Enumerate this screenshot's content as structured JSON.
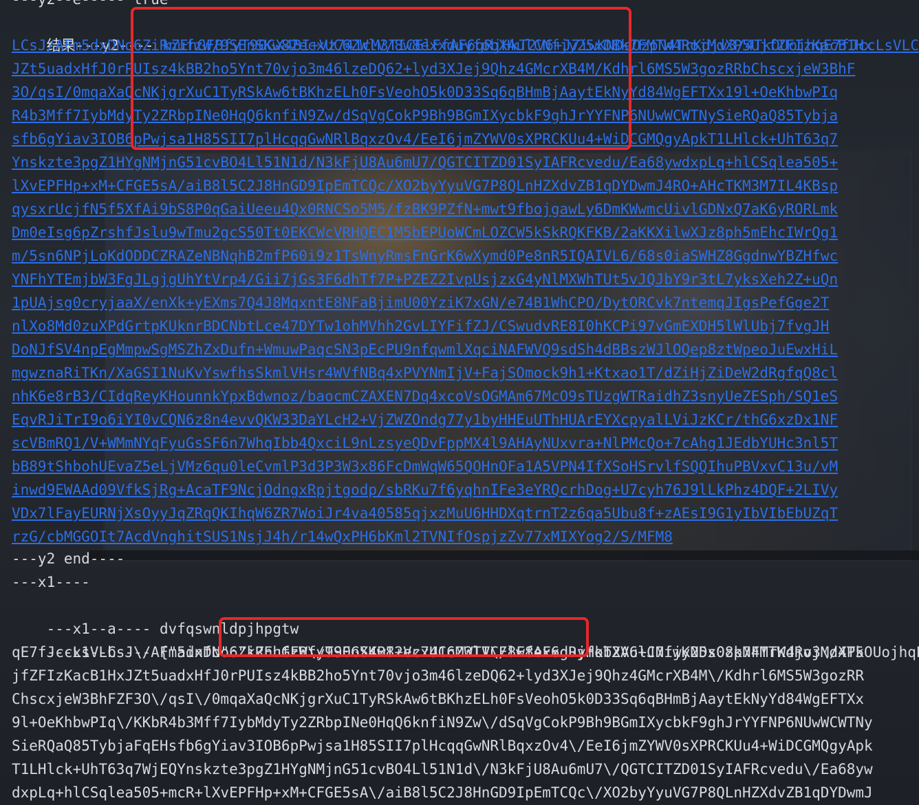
{
  "terminal": {
    "top_partial_line": "---y2--e----- true",
    "y2_prefix": "结果---y2---- ",
    "y2_lines": [
      "kZEhGFBfyT90GX4BI+Vz741cM3TICElFfAF6gRjHkT2V6+J7iwKNDsOzpN4TrKdjv3/4TkOUojhqE7fJccLsVLCsJ",
      "LCsJ/AFm5dxDNo6ZiRnufzW/9SEnSKw82ecxUC6ZWlV/8w8exxduyfobXAulCNfjy25x08k7FMTW4RojMdXP5UjfZFIzKacB1Hx",
      "JZt5uadxHfJ0rPUIsz4kBB2ho5Ynt70vjo3m46lzeDQ62+lyd3XJej9Qhz4GMcrXB4M/Kdhrl6MS5W3gozRRbChscxjeW3BhF",
      "3O/qsI/0mqaXaQcNKjgrXuC1TyRSkAw6tBKhzELh0FsVeohO5k0D33Sq6qBHmBjAaytEkNyYd84WgEFTXx19l+OeKhbwPIq",
      "R4b3Mff7IybMdyTy2ZRbpINe0HqQ6knfiN9Zw/dSqVgCokP9Bh9BGmIXycbkF9ghJrYYFNP6NUwWCWTNySieRQaQ85Tybja",
      "sfb6gYiav3IOB6pPwjsa1H85SII7plHcqqGwNRlBqxzOv4/EeI6jmZYWV0sXPRCKUu4+WiDCGMQgyApkT1LHlck+UhT63q7",
      "Ynskzte3pgZ1HYgNMjnG51cvBO4Ll51N1d/N3kFjU8Au6mU7/QGTCITZD01SyIAFRcvedu/Ea68ywdxpLq+hlCSqlea505+",
      "lXvEPFHp+xM+CFGE5sA/aiB8l5C2J8HnGD9IpEmTCQc/XO2byYyuVG7P8QLnHZXdvZB1qDYDwmJ4RO+AHcTKM3M7IL4KBsp",
      "qysxrUcjfN5f5XfAi9bS8P0qGaiUeeu4Qx0RNCSo5M5/fzBK9PZfN+mwt9fbojgawLy6DmKWwmcUivlGDNxQ7aK6yRORLmk",
      "Dm0eIsg6pZrshfJslu9wTmu2gcS50Tt0EKCWcVRHQEC1M5bEPUoWCmLOZCW5kSkRQKFKB/2aKKXilwXJz8ph5mEhcIWrQg1",
      "m/5sn6NPjLoKdODDCZRAZeNBNqhB2mfP60i9z1TsWnyRmsFnGrK6wXymd0Pe8nR5IQAIVL6/68s0iaSWHZ8GgdnwYBZHfwc",
      "YNFhYTEmjbW3FgJLgjgUhYtVrp4/Gii7jGs3F6dhTf7P+PZEZ2IvpUsjzxG4yNlMXWhTUt5vJQJbY9r3tL7yksXeh2Z+uQn",
      "1pUAjsg0cryjaaX/enXk+yEXms7Q4J8MqxntE8NFaBjimU00YziK7xGN/e74B1WhCPO/DytORCvk7ntemqJIgsPefGge2T",
      "nlXo8Md0zuXPdGrtpKUknrBDCNbtLce47DYTw1ohMVhh2GvLIYFifZJ/CSwudvRE8I0hKCPi97vGmEXDH5lWlUbj7fvgJH",
      "DoNJfSV4npEgMmpwSgMSZhZxDufn+WmuwPaqcSN3pEcPU9nfqwmlXqciNAFWVQ9sdSh4dBBszWJlOQep8ztWpeoJuEwxHiL",
      "mgwznaRiTKn/XaGSI1NuKvYswfhsSkmlVHsr4WVfNBq4xPVYNmIjV+FajSOmock9h1+Ktxao1T/dZiHjZiDeW2dRgfqQ8cl",
      "nhK6e8rB3/CIdqReyKHounnkYpxBdwnoz/baocmCZAXEN7Dq4xcoVsOGMAm67McO9sTUzgWTRaidhZ3snyUeZESph/SQ1eS",
      "EqvRJiTrI9o6iYI0vCQN6z8n4evvQKW33DaYLcH2+VjZWZOndg77y1byHHEuUThHUArEYXcpyalLViJzKCr/thG6xzDx1NF",
      "scVBmRQ1/V+WMmNYqFyuGsSF6n7WhqIbb4QxciL9nLzsyeQDvFppMX4l9AHAyNUxvra+NlPMcQo+7cAhg1JEdbYUHc3nl5T",
      "bB89tShbohUEvaZ5eLjVMz6qu0leCvmlP3d3P3W3x86FcDmWqW65QOHnOFa1A5VPN4IfXSoHSrvlfSQQIhuPBVxvC13u/vM",
      "inwd9EWAAd09VfkSjRg+AcaTF9NcjOdngxRpjtgodp/sbRKu7f6yqhnIFe3eYRQcrhDog+U7cyh76J9lLkPhz4DQF+2LIVy",
      "VDx7lFayEURNjXsOyyJqZRqQKIhqW6ZR7WoiJr4va40585qjxzMuU6HHDXqtrnT2z6qa5Ubu8f+zAEsI9G1yIbVIbEbUZqT",
      "rzG/cbMGGOIt7AcdVnghitSUS1NsjJ4h/r14wQxPH6bKml2TVNIfOspjzZv77xMIXYog2/S/MFM8"
    ],
    "y2_end": "---y2 end----",
    "x1_header": "---x1----",
    "x1_a_label": "---x1--a---- ",
    "x1_a_value": "dvfqswnldpjhpgtw",
    "x1_b_label": "---x1--b---- ",
    "x1_b_open": "{\"ainfo\":",
    "x1_b_value_start": "\"kZEhGFBfyT90GX4BI+Vz741cM3TICElFfAF6gRjHkT2V6+J7iwKNDsOzpN4TrKdjv3\\/4TkOUojhqE7",
    "x1_b_lines": [
      "qE7fJccLsVLCsJ\\/AFm5dxDNo6ZiRnufzW\\/9SEnSKw82ecxUC6ZWlV\\/8w8exxduyfobXAulCNfjy25x08k7FMTW4RojMdXP5",
      "jfZFIzKacB1HxJZt5uadxHfJ0rPUIsz4kBB2ho5Ynt70vjo3m46lzeDQ62+lyd3XJej9Qhz4GMcrXB4M\\/Kdhrl6MS5W3gozRR",
      "ChscxjeW3BhFZF3O\\/qsI\\/0mqaXaQcNKjgrXuC1TyRSkAw6tBKhzELh0FsVeohO5k0D33Sq6qBHmBjAaytEkNyYd84WgEFTXx",
      "9l+OeKhbwPIq\\/KKbR4b3Mff7IybMdyTy2ZRbpINe0HqQ6knfiN9Zw\\/dSqVgCokP9Bh9BGmIXycbkF9ghJrYYFNP6NUwWCWTNy",
      "SieRQaQ85TybjaFqEHsfb6gYiav3IOB6pPwjsa1H85SII7plHcqqGwNRlBqxzOv4\\/EeI6jmZYWV0sXPRCKUu4+WiDCGMQgyApk",
      "T1LHlck+UhT63q7WjEQYnskzte3pgZ1HYgNMjnG51cvBO4Ll51N1d\\/N3kFjU8Au6mU7\\/QGTCITZD01SyIAFRcvedu\\/Ea68yw",
      "dxpLq+hlCSqlea505+mcR+lXvEPFHp+xM+CFGE5sA\\/aiB8l5C2J8HnGD9IpEmTCQc\\/XO2byYyuVG7P8QLnHZXdvZB1qDYDwmJ"
    ]
  },
  "colors": {
    "link": "#2b6fe6",
    "text": "#d7dadf",
    "highlight": "#e8282a"
  }
}
